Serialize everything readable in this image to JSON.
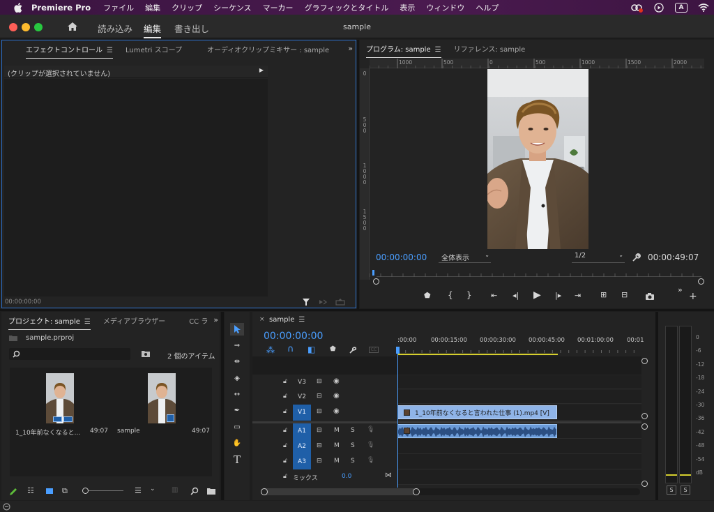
{
  "menubar": {
    "app_name": "Premiere Pro",
    "items": [
      "ファイル",
      "編集",
      "クリップ",
      "シーケンス",
      "マーカー",
      "グラフィックとタイトル",
      "表示",
      "ウィンドウ",
      "ヘルプ"
    ],
    "status_text": "A"
  },
  "titlebar": {
    "workspaces": [
      "読み込み",
      "編集",
      "書き出し"
    ],
    "active_workspace": "編集",
    "document_title": "sample"
  },
  "effect_panel": {
    "tabs": [
      "エフェクトコントロール",
      "Lumetri スコープ",
      "オーディオクリップミキサー : sample"
    ],
    "no_clip_text": "(クリップが選択されていません)",
    "timecode": "00:00:00:00"
  },
  "program_panel": {
    "tabs": [
      "プログラム: sample",
      "リファレンス: sample"
    ],
    "ruler_labels": [
      "1000",
      "500",
      "0",
      "500",
      "1000",
      "1500",
      "2000"
    ],
    "vruler_labels": [
      [
        "0"
      ],
      [
        "5",
        "0",
        "0"
      ],
      [
        "1",
        "0",
        "0",
        "0"
      ],
      [
        "1",
        "5",
        "0",
        "0"
      ]
    ],
    "current_timecode": "00:00:00:00",
    "zoom_select": "全体表示",
    "resolution_select": "1/2",
    "duration": "00:00:49:07"
  },
  "project_panel": {
    "tabs": [
      "プロジェクト: sample",
      "メディアブラウザー",
      "CC ラ"
    ],
    "project_file": "sample.prproj",
    "item_count": "2 個のアイテム",
    "items": [
      {
        "name": "1_10年前なくなると...",
        "duration": "49:07"
      },
      {
        "name": "sample",
        "duration": "49:07"
      }
    ]
  },
  "timeline": {
    "tab": "sample",
    "timecode": "00:00:00:00",
    "ruler_labels": [
      ":00:00",
      "00:00:15:00",
      "00:00:30:00",
      "00:00:45:00",
      "00:01:00:00",
      "00:01"
    ],
    "video_tracks": [
      "V3",
      "V2",
      "V1"
    ],
    "audio_tracks": [
      "A1",
      "A2",
      "A3"
    ],
    "mix_label": "ミックス",
    "mix_value": "0.0",
    "video_clip_name": "1_10年前なくなると言われた仕事 (1).mp4 [V]",
    "mute_label": "M",
    "solo_label": "S"
  },
  "meters": {
    "scale": [
      "0",
      "-6",
      "-12",
      "-18",
      "-24",
      "-30",
      "-36",
      "-42",
      "-48",
      "-54",
      "dB"
    ],
    "solo_labels": [
      "S",
      "S"
    ]
  },
  "colors": {
    "accent_blue": "#2d6fc9",
    "timecode_blue": "#4a9eff",
    "clip_blue": "#8fb4e8",
    "audio_clip": "#6b9bd8",
    "track_target": "#1f5fa8",
    "work_area_yellow": "#d6cf2e"
  }
}
